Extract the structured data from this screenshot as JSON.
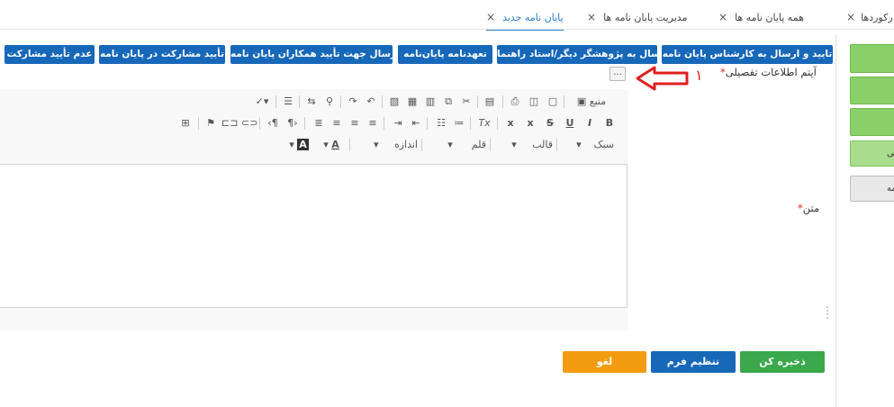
{
  "tabs": [
    {
      "label": "همه رکوردها",
      "close": "×"
    },
    {
      "label": "همه پایان نامه ها",
      "close": "×"
    },
    {
      "label": "مدیریت پایان نامه ها",
      "close": "×"
    },
    {
      "label": "پایان نامه جدید",
      "close": "×"
    }
  ],
  "actions": [
    "تایید و ارسال به کارشناس پایان نامه",
    "ارسال به پژوهشگر دیگر/استاد راهنما",
    "تعهدنامه پایان‌نامه",
    "ارسال جهت تأیید همکاران پایان نامه",
    "تأیید مشارکت در پایان نامه",
    "عدم تأیید مشارکت"
  ],
  "sidebar": {
    "btn4": "لی",
    "btn5": "ن نامه"
  },
  "form": {
    "detail_label": "آیتم اطلاعات تفصیلی",
    "text_label": "متن",
    "required_mark": "*",
    "ellipsis": "...",
    "annotation_number": "۱"
  },
  "editor": {
    "source": "منبع",
    "style": "سبک",
    "format": "قالب",
    "font": "قلم",
    "size": "اندازه",
    "bold": "B",
    "italic": "I",
    "underline": "U",
    "strike": "S",
    "subscript": "x",
    "superscript": "x",
    "text_color": "A",
    "bg_color": "A",
    "dropdown": "▾"
  },
  "buttons": {
    "save": "ذخیره کن",
    "arrange": "تنظیم فرم",
    "cancel": "لغو"
  },
  "colors": {
    "primary": "#1768b9",
    "save": "#3aa84b",
    "arrange": "#1768b9",
    "cancel": "#f39c12",
    "annotation": "#e02020"
  }
}
